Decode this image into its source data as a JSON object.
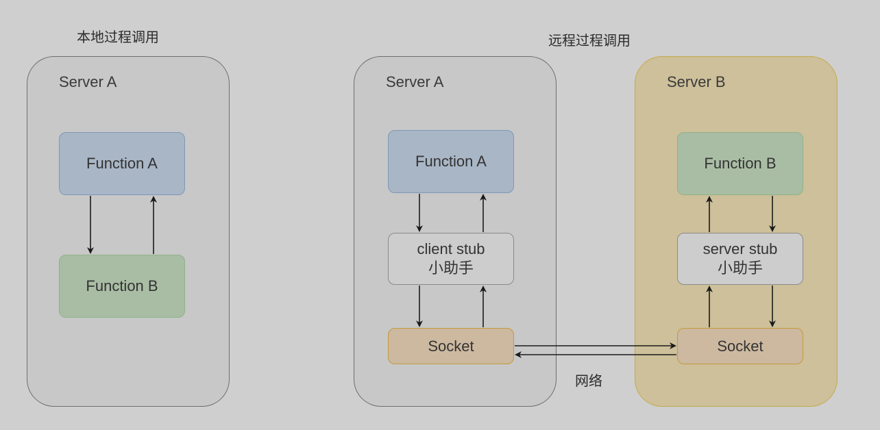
{
  "local": {
    "title": "本地过程调用",
    "server_label": "Server A",
    "function_a": "Function A",
    "function_b": "Function B"
  },
  "remote": {
    "title": "远程过程调用",
    "server_a": {
      "label": "Server A",
      "function": "Function A",
      "stub_line1": "client stub",
      "stub_line2": "小助手",
      "socket": "Socket"
    },
    "server_b": {
      "label": "Server B",
      "function": "Function B",
      "stub_line1": "server stub",
      "stub_line2": "小助手",
      "socket": "Socket"
    },
    "network_label": "网络"
  },
  "colors": {
    "background": "#cfcfcf",
    "function_a_fill": "#a9b6c6",
    "function_b_fill": "#a9bda4",
    "stub_fill": "#cdcdcd",
    "socket_fill": "#cdb9a0",
    "server_b_fill": "#cdc09a"
  }
}
